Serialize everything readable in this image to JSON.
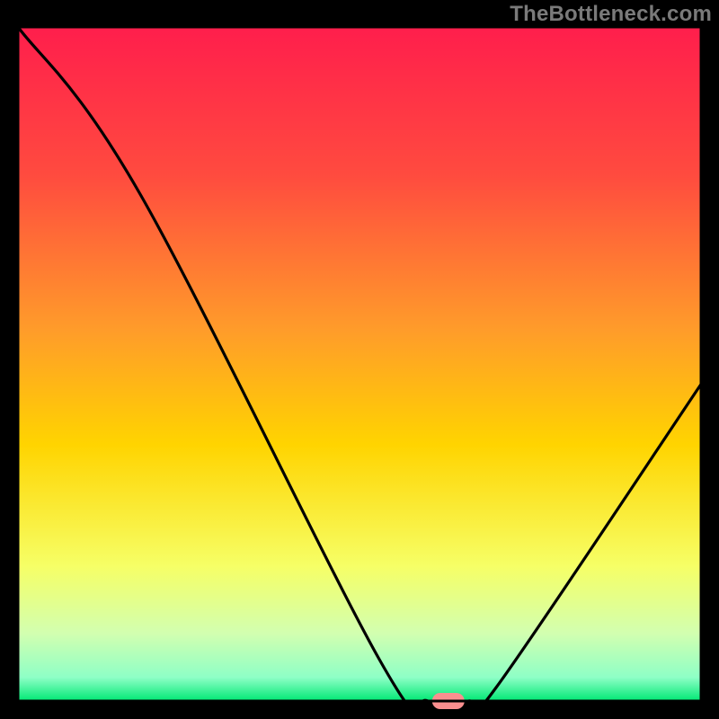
{
  "watermark": "TheBottleneck.com",
  "chart_data": {
    "type": "line",
    "title": "",
    "xlabel": "",
    "ylabel": "",
    "xlim": [
      0,
      100
    ],
    "ylim": [
      0,
      100
    ],
    "series": [
      {
        "name": "curve",
        "x": [
          0,
          18,
          53,
          60,
          66,
          70,
          100
        ],
        "y": [
          100,
          75,
          6,
          0,
          0,
          2,
          47
        ]
      }
    ],
    "marker": {
      "x": 63,
      "y": 0,
      "color": "#fa8f8f"
    },
    "background_gradient": {
      "top": "#ff1e4c",
      "mid_upper": "#ff9130",
      "mid": "#ffd400",
      "mid_lower": "#f6ff66",
      "bottom": "#00e874"
    },
    "frame_color": "#000000",
    "curve_color": "#000000"
  }
}
